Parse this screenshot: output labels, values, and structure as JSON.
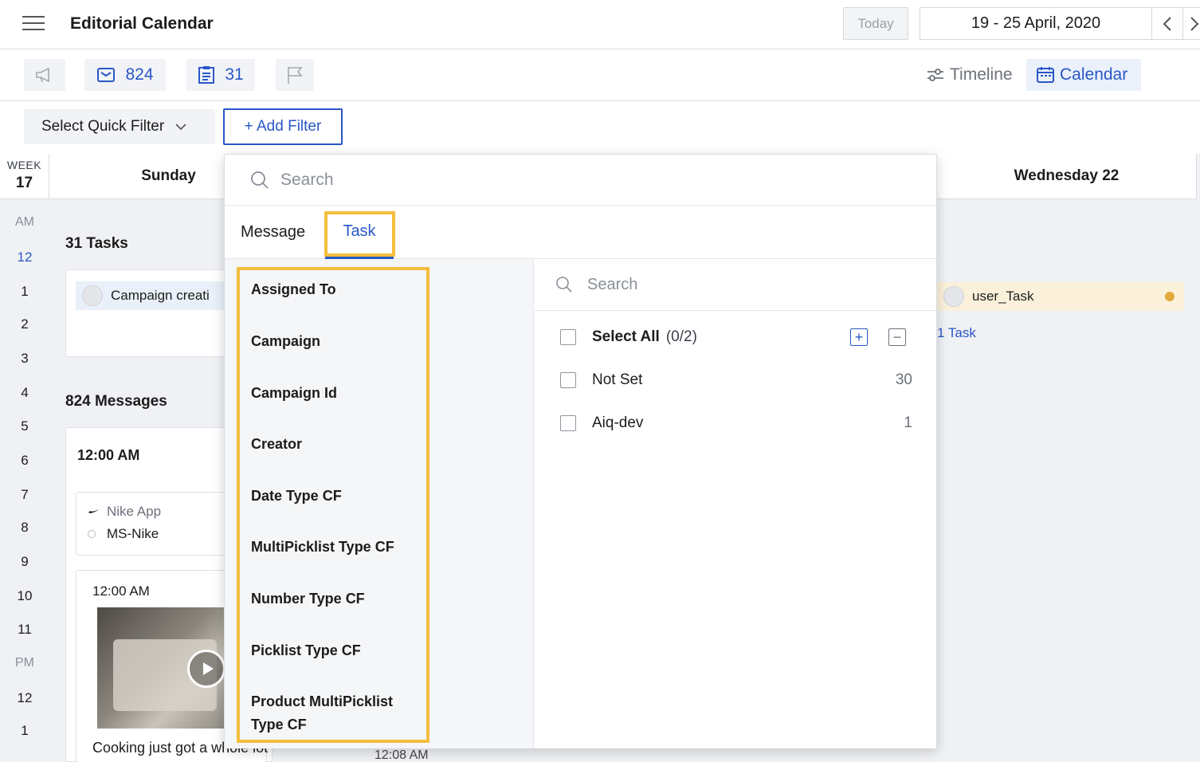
{
  "header": {
    "title": "Editorial Calendar",
    "today_label": "Today",
    "date_range": "19 - 25 April, 2020"
  },
  "toolbar": {
    "messages_count": "824",
    "tasks_count": "31",
    "timeline_label": "Timeline",
    "calendar_label": "Calendar"
  },
  "filters": {
    "quick_filter_label": "Select Quick Filter",
    "add_filter_label": "+ Add Filter"
  },
  "calendar": {
    "week_label": "WEEK",
    "week_number": "17",
    "am_label": "AM",
    "pm_label": "PM",
    "hours_am": [
      "12",
      "1",
      "2",
      "3",
      "4",
      "5",
      "6",
      "7",
      "8",
      "9",
      "10",
      "11"
    ],
    "hours_pm": [
      "12",
      "1"
    ],
    "days": [
      {
        "label": "Sunday"
      },
      {
        "label": "Wednesday 22"
      }
    ],
    "sunday": {
      "tasks_title": "31 Tasks",
      "task_chip": "Campaign creati",
      "messages_title": "824 Messages",
      "time_slot": "12:00 AM",
      "post1_app": "Nike App",
      "post1_account": "MS-Nike",
      "post2_time": "12:00 AM",
      "post2_caption": "Cooking just got a whole lot",
      "next_time": "12:08 AM"
    },
    "wednesday": {
      "task_chip": "user_Task",
      "task_link": "1 Task"
    }
  },
  "dropdown": {
    "search_placeholder": "Search",
    "tabs": [
      {
        "label": "Message"
      },
      {
        "label": "Task"
      }
    ],
    "fields": [
      {
        "label": "Assigned To"
      },
      {
        "label": "Campaign"
      },
      {
        "label": "Campaign Id"
      },
      {
        "label": "Creator"
      },
      {
        "label": "Date Type CF"
      },
      {
        "label": "MultiPicklist Type CF"
      },
      {
        "label": "Number Type CF"
      },
      {
        "label": "Picklist Type CF"
      },
      {
        "label": "Product MultiPicklist Type CF"
      }
    ],
    "values_search_placeholder": "Search",
    "select_all_label": "Select All",
    "select_all_count": "(0/2)",
    "options": [
      {
        "label": "Not Set",
        "count": "30"
      },
      {
        "label": "Aiq-dev",
        "count": "1"
      }
    ]
  },
  "colors": {
    "accent": "#2a57c7",
    "highlight": "#f4be3e",
    "status_dot": "#e2a93b"
  }
}
